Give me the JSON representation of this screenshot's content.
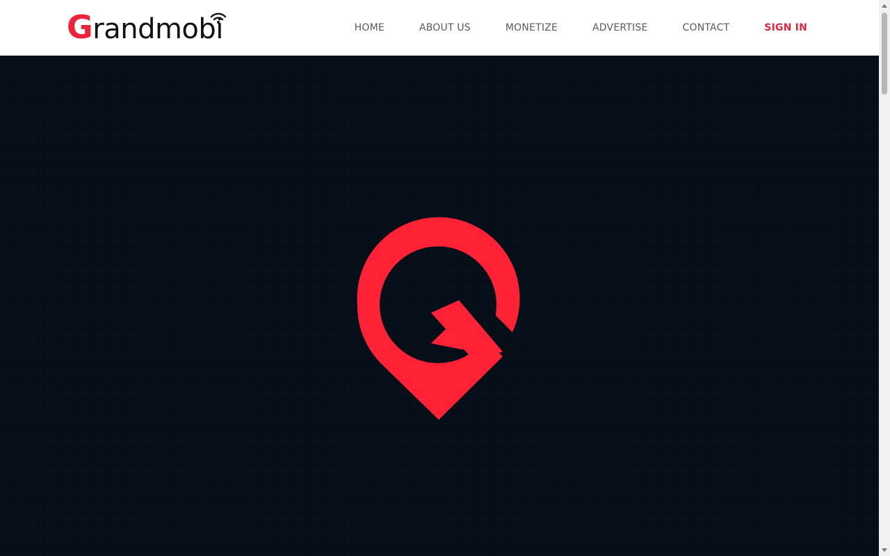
{
  "brand": {
    "name": "Grandmobi",
    "initial": "G",
    "rest": "randmobi",
    "primary_color": "#f0223a",
    "logo_icon": "wifi-signal-icon"
  },
  "nav": {
    "items": [
      {
        "label": "HOME"
      },
      {
        "label": "ABOUT US"
      },
      {
        "label": "MONETIZE"
      },
      {
        "label": "ADVERTISE"
      },
      {
        "label": "CONTACT"
      }
    ],
    "signin_label": "SIGN IN",
    "signin_color": "#e8253c"
  },
  "hero": {
    "background_color": "#050d16",
    "mark_icon": "location-pin-g-icon",
    "mark_color": "#ff2236"
  },
  "scrollbar": {
    "icons": [
      "chevron-up-icon",
      "chevron-down-icon"
    ]
  }
}
